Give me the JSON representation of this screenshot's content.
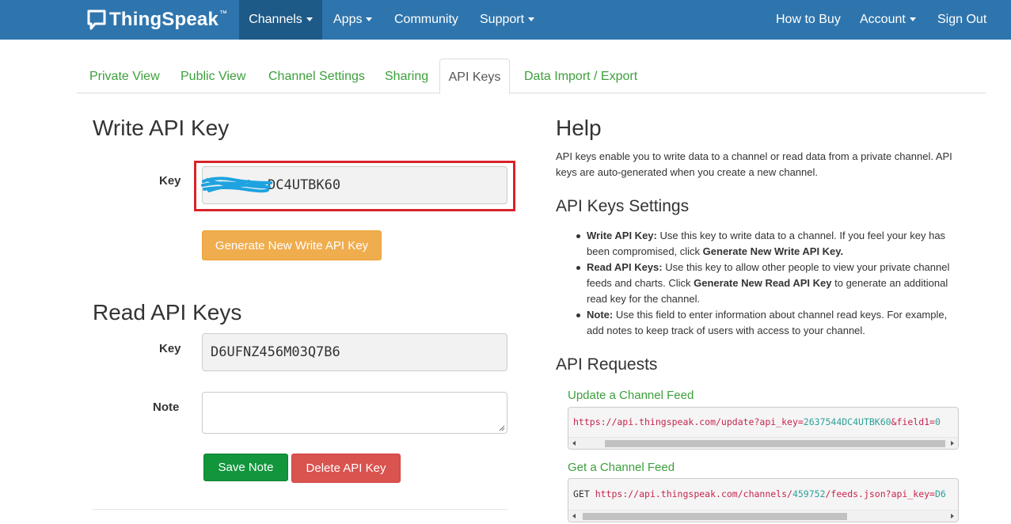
{
  "navbar": {
    "brand": "ThingSpeak",
    "brand_tm": "™",
    "items": {
      "channels": "Channels",
      "apps": "Apps",
      "community": "Community",
      "support": "Support",
      "how_to_buy": "How to Buy",
      "account": "Account",
      "sign_out": "Sign Out"
    }
  },
  "tabs": {
    "private_view": "Private View",
    "public_view": "Public View",
    "channel_settings": "Channel Settings",
    "sharing": "Sharing",
    "api_keys": "API Keys",
    "data_import_export": "Data Import / Export"
  },
  "write_key": {
    "heading": "Write API Key",
    "label": "Key",
    "value_visible": "DC4UTBK60",
    "generate_button": "Generate New Write API Key"
  },
  "read_keys": {
    "heading": "Read API Keys",
    "key_label": "Key",
    "key_value": "D6UFNZ456M03Q7B6",
    "note_label": "Note",
    "note_value": "",
    "save_button": "Save Note",
    "delete_button": "Delete API Key"
  },
  "help": {
    "heading": "Help",
    "intro_line1": "API keys enable you to write data to a channel or read data from a private channel. API",
    "intro_line2": "keys are auto-generated when you create a new channel.",
    "settings_heading": "API Keys Settings",
    "bullets": [
      {
        "title": "Write API Key:",
        "line1": " Use this key to write data to a channel. If you feel your key has",
        "line2a": "been compromised, click ",
        "line2b": "Generate New Write API Key."
      },
      {
        "title": "Read API Keys:",
        "line1": " Use this key to allow other people to view your private channel",
        "line2a": "feeds and charts. Click ",
        "line2b": "Generate New Read API Key",
        "line2c": " to generate an additional",
        "line3": "read key for the channel."
      },
      {
        "title": "Note:",
        "line1": " Use this field to enter information about channel read keys. For example,",
        "line2": "add notes to keep track of users with access to your channel."
      }
    ],
    "requests_heading": "API Requests",
    "update_title": "Update a Channel Feed",
    "update_url": {
      "base": "https://api.thingspeak.com/update?api_key=",
      "key": "2637544DC4UTBK60",
      "rest": "&field1=",
      "val": "0"
    },
    "get_title": "Get a Channel Feed",
    "get_url": {
      "method": "GET ",
      "base": "https://api.thingspeak.com/channels/",
      "channel": "459752",
      "rest": "/feeds.json?api_key=",
      "key": "D6"
    }
  },
  "colors": {
    "navbar": "#2f75ad",
    "navbar_active": "#1e5a87",
    "link_green": "#3ca03c",
    "highlight_red": "#d9232a",
    "warning": "#f0ad4e",
    "success": "#12963c",
    "danger": "#d9534f",
    "scribble_blue": "#1fa3e0"
  }
}
